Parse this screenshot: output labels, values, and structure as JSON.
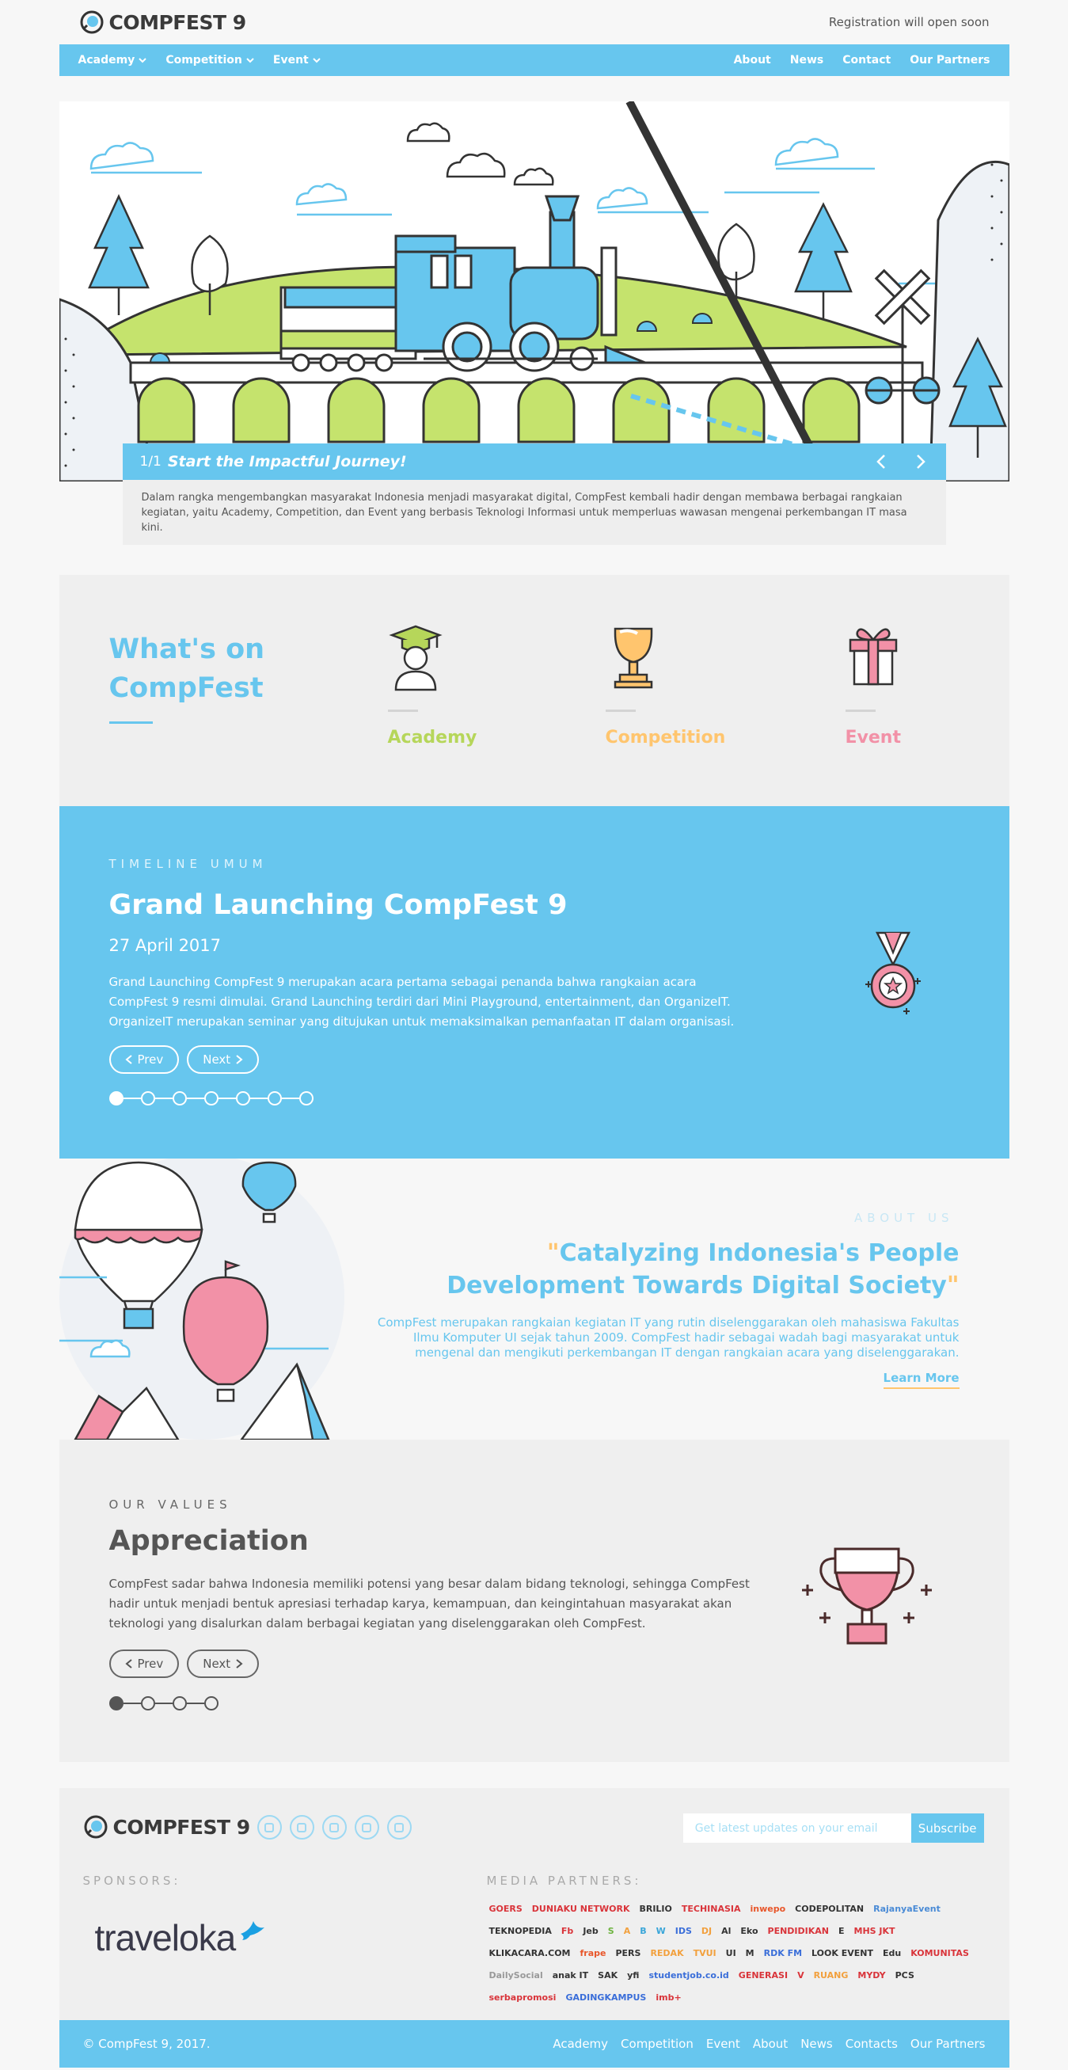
{
  "header": {
    "logo_text": "COMPFEST 9",
    "registration_note": "Registration will open soon"
  },
  "nav": {
    "left": [
      {
        "label": "Academy",
        "icon": "chevron-down-icon"
      },
      {
        "label": "Competition",
        "icon": "chevron-down-icon"
      },
      {
        "label": "Event",
        "icon": "chevron-down-icon"
      }
    ],
    "right": [
      "About",
      "News",
      "Contact",
      "Our Partners"
    ]
  },
  "hero": {
    "slide_number": "1/1",
    "slide_title": "Start the Impactful Journey!",
    "description": "Dalam rangka mengembangkan masyarakat Indonesia menjadi masyarakat digital, CompFest kembali hadir dengan membawa berbagai rangkaian kegiatan, yaitu Academy, Competition, dan Event yang berbasis Teknologi Informasi untuk memperluas wawasan mengenai perkembangan IT masa kini."
  },
  "whats_on": {
    "title": "What's on CompFest",
    "categories": [
      {
        "label": "Academy",
        "color": "#b6d65a",
        "icon": "graduate-icon"
      },
      {
        "label": "Competition",
        "color": "#ffc56e",
        "icon": "trophy-icon"
      },
      {
        "label": "Event",
        "color": "#f291a7",
        "icon": "gift-icon"
      }
    ]
  },
  "timeline": {
    "kicker": "TIMELINE UMUM",
    "title": "Grand Launching CompFest 9",
    "date": "27 April 2017",
    "description": "Grand Launching CompFest 9 merupakan acara pertama sebagai penanda bahwa rangkaian acara CompFest 9 resmi dimulai. Grand Launching terdiri dari Mini Playground, entertainment, dan OrganizeIT. OrganizeIT merupakan seminar yang ditujukan untuk memaksimalkan pemanfaatan IT dalam organisasi.",
    "prev_label": "Prev",
    "next_label": "Next",
    "total_steps": 7,
    "active_step": 1
  },
  "about": {
    "kicker": "ABOUT US",
    "quote_open": "\"",
    "quote": "Catalyzing Indonesia's People Development Towards Digital Society",
    "quote_close": "\"",
    "description": "CompFest merupakan rangkaian kegiatan IT yang rutin diselenggarakan oleh mahasiswa Fakultas Ilmu Komputer UI sejak tahun 2009. CompFest hadir sebagai wadah bagi masyarakat untuk mengenal dan mengikuti perkembangan IT dengan rangkaian acara yang diselenggarakan.",
    "learn_more": "Learn More"
  },
  "values": {
    "kicker": "OUR VALUES",
    "title": "Appreciation",
    "description": "CompFest sadar bahwa Indonesia memiliki potensi yang besar dalam bidang teknologi, sehingga CompFest hadir untuk menjadi bentuk apresiasi terhadap karya, kemampuan, dan keingintahuan masyarakat akan teknologi yang disalurkan dalam berbagai kegiatan yang diselenggarakan oleh CompFest.",
    "prev_label": "Prev",
    "next_label": "Next",
    "total_steps": 4,
    "active_step": 1
  },
  "footer": {
    "logo_text": "COMPFEST 9",
    "socials": [
      "facebook-icon",
      "instagram-icon",
      "twitter-icon",
      "line-icon",
      "youtube-icon"
    ],
    "subscribe_placeholder": "Get latest updates on your email",
    "subscribe_label": "Subscribe",
    "sponsors_label": "SPONSORS:",
    "sponsor_name": "traveloka",
    "media_label": "MEDIA PARTNERS:",
    "media_partners": [
      {
        "name": "GOERS",
        "color": "#d9343a"
      },
      {
        "name": "DUNIAKU NETWORK",
        "color": "#d9343a"
      },
      {
        "name": "BRILIO",
        "color": "#333333"
      },
      {
        "name": "TECHINASIA",
        "color": "#d9343a"
      },
      {
        "name": "inwepo",
        "color": "#e8562a"
      },
      {
        "name": "CODEPOLITAN",
        "color": "#333333"
      },
      {
        "name": "RajanyaEvent",
        "color": "#4a8bd6"
      },
      {
        "name": "TEKNOPEDIA",
        "color": "#333333"
      },
      {
        "name": "Fb",
        "color": "#d9343a"
      },
      {
        "name": "Jeb",
        "color": "#333333"
      },
      {
        "name": "S",
        "color": "#6db33f"
      },
      {
        "name": "A",
        "color": "#f2a03d"
      },
      {
        "name": "B",
        "color": "#3aa6d9"
      },
      {
        "name": "W",
        "color": "#3aa6d9"
      },
      {
        "name": "IDS",
        "color": "#3a6ed9"
      },
      {
        "name": "DJ",
        "color": "#f2a03d"
      },
      {
        "name": "Al",
        "color": "#333333"
      },
      {
        "name": "Eko",
        "color": "#333333"
      },
      {
        "name": "PENDIDIKAN",
        "color": "#d9343a"
      },
      {
        "name": "E",
        "color": "#333333"
      },
      {
        "name": "MHS JKT",
        "color": "#d9343a"
      },
      {
        "name": "KLIKACARA.COM",
        "color": "#333333"
      },
      {
        "name": "frape",
        "color": "#e8562a"
      },
      {
        "name": "PERS",
        "color": "#333333"
      },
      {
        "name": "REDAK",
        "color": "#f2a03d"
      },
      {
        "name": "TVUI",
        "color": "#f2a03d"
      },
      {
        "name": "UI",
        "color": "#333333"
      },
      {
        "name": "M",
        "color": "#333333"
      },
      {
        "name": "RDK FM",
        "color": "#3a6ed9"
      },
      {
        "name": "LOOK EVENT",
        "color": "#333333"
      },
      {
        "name": "Edu",
        "color": "#333333"
      },
      {
        "name": "KOMUNITAS",
        "color": "#d9343a"
      },
      {
        "name": "DailySocial",
        "color": "#999999"
      },
      {
        "name": "anak IT",
        "color": "#333333"
      },
      {
        "name": "SAK",
        "color": "#333333"
      },
      {
        "name": "yfi",
        "color": "#333333"
      },
      {
        "name": "studentjob.co.id",
        "color": "#3a6ed9"
      },
      {
        "name": "GENERASI",
        "color": "#d9343a"
      },
      {
        "name": "V",
        "color": "#d9343a"
      },
      {
        "name": "RUANG",
        "color": "#f2a03d"
      },
      {
        "name": "MYDY",
        "color": "#d9343a"
      },
      {
        "name": "PCS",
        "color": "#333333"
      },
      {
        "name": "serbapromosi",
        "color": "#d9343a"
      },
      {
        "name": "GADINGKAMPUS",
        "color": "#3a6ed9"
      },
      {
        "name": "imb+",
        "color": "#d9343a"
      }
    ],
    "copyright": "© CompFest 9, 2017.",
    "links": [
      "Academy",
      "Competition",
      "Event",
      "About",
      "News",
      "Contacts",
      "Our Partners"
    ]
  },
  "colors": {
    "accent": "#67c6ee",
    "academy": "#b6d65a",
    "competition": "#ffc56e",
    "event": "#f291a7"
  }
}
